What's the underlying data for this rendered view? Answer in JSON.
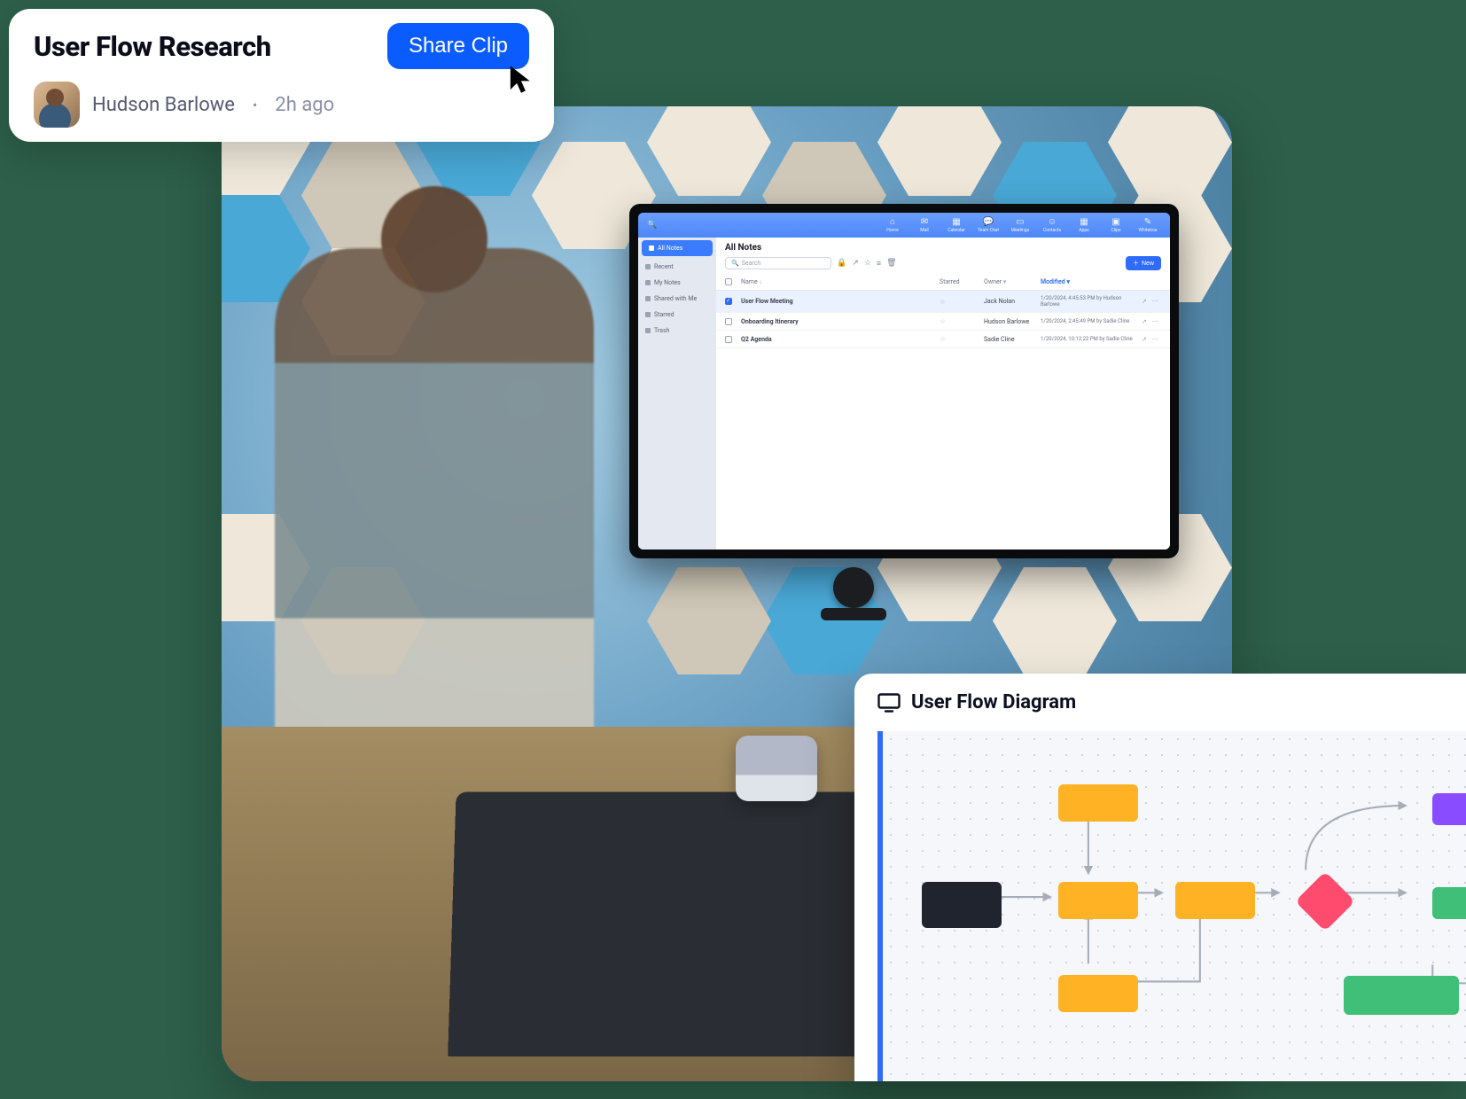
{
  "clip": {
    "title": "User Flow Research",
    "author": "Hudson Barlowe",
    "time": "2h ago",
    "share_label": "Share Clip"
  },
  "tv": {
    "topbar_search_placeholder": "Search",
    "nav": [
      {
        "label": "Home",
        "icon": "⌂"
      },
      {
        "label": "Mail",
        "icon": "✉"
      },
      {
        "label": "Calendar",
        "icon": "▦"
      },
      {
        "label": "Team Chat",
        "icon": "💬"
      },
      {
        "label": "Meetings",
        "icon": "▭"
      },
      {
        "label": "Contacts",
        "icon": "☺"
      },
      {
        "label": "Apps",
        "icon": "▦"
      },
      {
        "label": "Clips",
        "icon": "▣"
      },
      {
        "label": "Whiteboa",
        "icon": "✎"
      }
    ],
    "sidebar": {
      "items": [
        {
          "label": "All Notes"
        },
        {
          "label": "Recent"
        },
        {
          "label": "My Notes"
        },
        {
          "label": "Shared with Me"
        },
        {
          "label": "Starred"
        },
        {
          "label": "Trash"
        }
      ]
    },
    "main": {
      "title": "All Notes",
      "search_placeholder": "Search",
      "new_label": "New",
      "columns": {
        "name": "Name",
        "starred": "Starred",
        "owner": "Owner",
        "modified": "Modified"
      },
      "rows": [
        {
          "selected": true,
          "name": "User Flow Meeting",
          "owner": "Jack Nolan",
          "modified": "1/20/2024, 4:45:53 PM by Hudson Barlowe"
        },
        {
          "selected": false,
          "name": "Onboarding Itinerary",
          "owner": "Hudson Barlowe",
          "modified": "1/20/2024, 2:45:49 PM by Sadie Cline"
        },
        {
          "selected": false,
          "name": "Q2 Agenda",
          "owner": "Sadie Cline",
          "modified": "1/20/2024, 10:12:22 PM by Sadie Cline"
        }
      ]
    }
  },
  "diagram": {
    "title": "User Flow Diagram"
  }
}
